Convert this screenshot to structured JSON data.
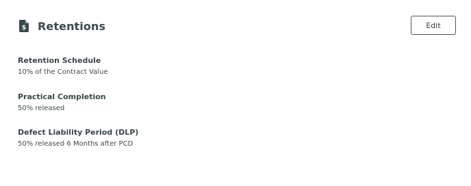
{
  "header": {
    "title": "Retentions",
    "icon": "document-dollar-icon"
  },
  "actions": {
    "edit_label": "Edit"
  },
  "fields": [
    {
      "label": "Retention Schedule",
      "value": "10% of the Contract Value"
    },
    {
      "label": "Practical Completion",
      "value": "50% released"
    },
    {
      "label": "Defect Liability Period (DLP)",
      "value": "50% released 6 Months after PCD"
    }
  ],
  "colors": {
    "icon": "#3b4a4d",
    "text": "#2f3b3e",
    "border": "#4b5558"
  }
}
